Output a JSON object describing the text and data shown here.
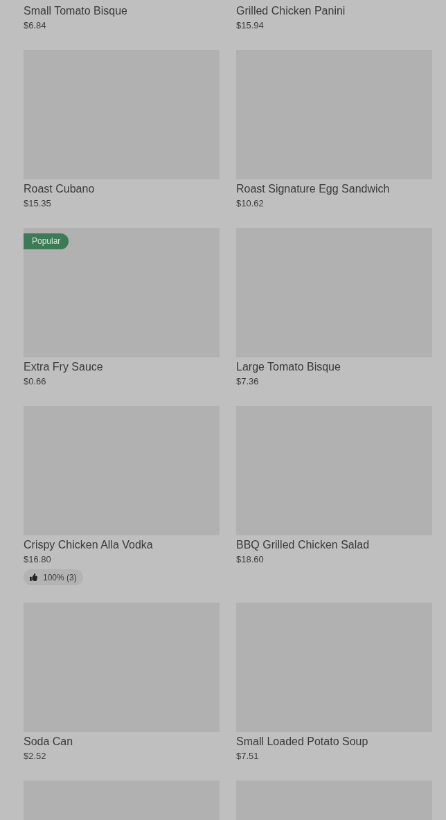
{
  "items": [
    {
      "name": "Small Tomato Bisque",
      "price": "$6.84",
      "photo": false
    },
    {
      "name": "Grilled Chicken Panini",
      "price": "$15.94",
      "photo": false
    },
    {
      "name": "Roast Cubano",
      "price": "$15.35",
      "photo": true
    },
    {
      "name": "Roast Signature Egg Sandwich",
      "price": "$10.62",
      "photo": true
    },
    {
      "name": "Extra Fry Sauce",
      "price": "$0.66",
      "photo": true,
      "badge": "Popular"
    },
    {
      "name": "Large Tomato Bisque",
      "price": "$7.36",
      "photo": true
    },
    {
      "name": "Crispy Chicken Alla Vodka",
      "price": "$16.80",
      "photo": true,
      "rating": "100% (3)"
    },
    {
      "name": "BBQ Grilled Chicken Salad",
      "price": "$18.60",
      "photo": true
    },
    {
      "name": "Soda Can",
      "price": "$2.52",
      "photo": true
    },
    {
      "name": "Small Loaded Potato Soup",
      "price": "$7.51",
      "photo": true
    },
    {
      "photo": true
    },
    {
      "photo": true
    }
  ]
}
